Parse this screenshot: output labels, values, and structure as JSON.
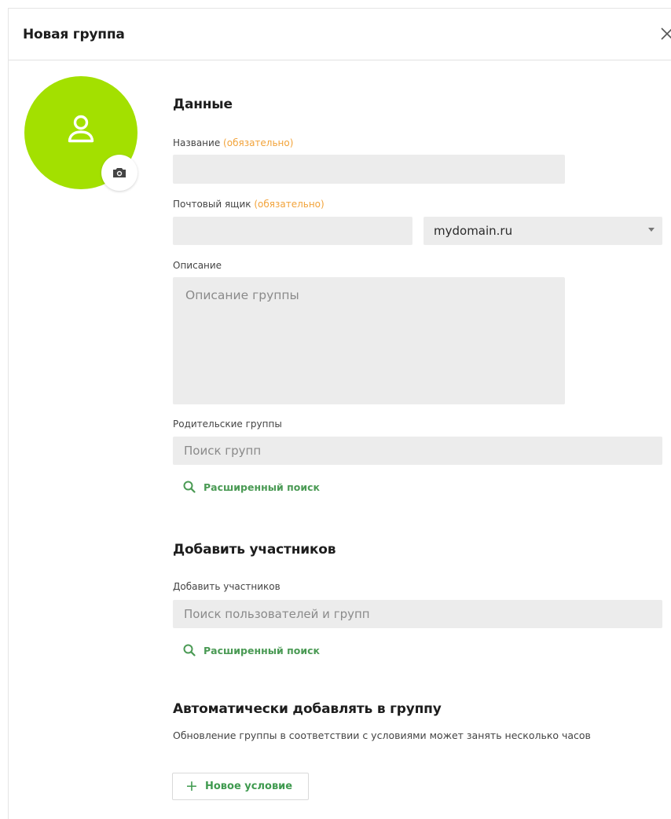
{
  "header": {
    "title": "Новая группа",
    "close_icon": "close-icon"
  },
  "avatar": {
    "color": "#a3e000",
    "person_icon": "user-icon",
    "camera_icon": "camera-icon"
  },
  "data_section": {
    "title": "Данные",
    "name_label": "Название",
    "name_required": "(обязательно)",
    "name_value": "",
    "mailbox_label": "Почтовый ящик",
    "mailbox_required": "(обязательно)",
    "mailbox_value": "",
    "domain_selected": "mydomain.ru",
    "description_label": "Описание",
    "description_placeholder": "Описание группы",
    "parent_label": "Родительские группы",
    "parent_placeholder": "Поиск групп",
    "advanced_search": "Расширенный поиск"
  },
  "members_section": {
    "title": "Добавить участников",
    "label": "Добавить участников",
    "placeholder": "Поиск пользователей и групп",
    "advanced_search": "Расширенный поиск"
  },
  "auto_section": {
    "title": "Автоматически добавлять в группу",
    "hint": "Обновление группы в соответствии с условиями может занять несколько часов",
    "new_condition_plus": "+",
    "new_condition_label": "Новое условие"
  },
  "colors": {
    "accent_green": "#3f9a4f",
    "required_orange": "#f2a33a",
    "field_bg": "#ececec"
  }
}
